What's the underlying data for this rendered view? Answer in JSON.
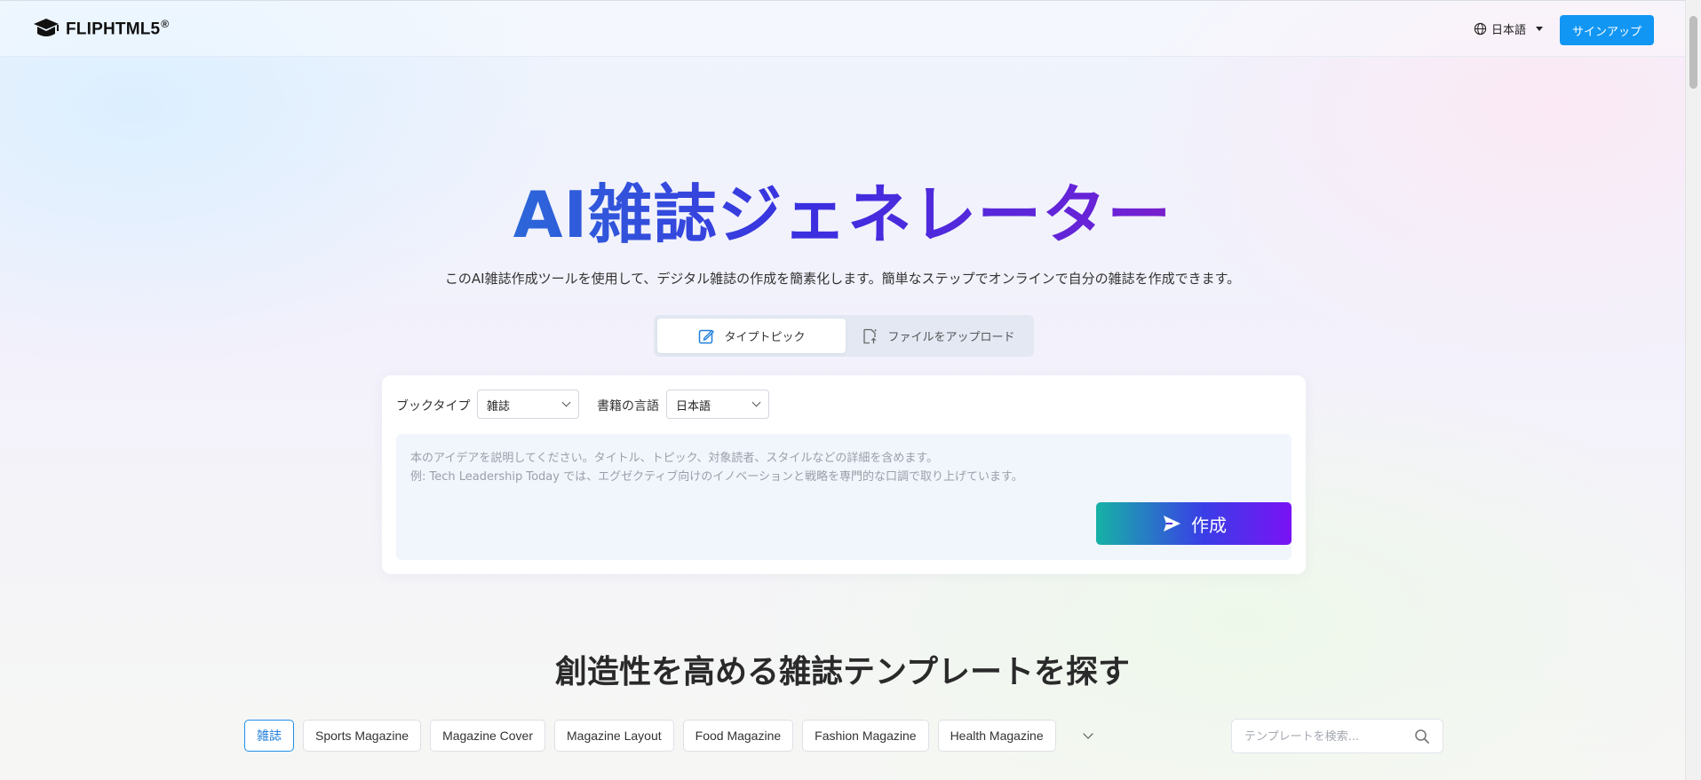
{
  "header": {
    "brand": "FLIPHTML5",
    "brand_mark": "®",
    "language": "日本語",
    "signup_label": "サインアップ"
  },
  "hero": {
    "title": "AI雑誌ジェネレーター",
    "subtitle": "このAI雑誌作成ツールを使用して、デジタル雑誌の作成を簡素化します。簡単なステップでオンラインで自分の雑誌を作成できます。",
    "tabs": [
      {
        "label": "タイプトピック",
        "icon": "edit-icon",
        "active": true
      },
      {
        "label": "ファイルをアップロード",
        "icon": "file-upload-icon",
        "active": false
      }
    ]
  },
  "form": {
    "book_type_label": "ブックタイプ",
    "book_type_value": "雑誌",
    "language_label": "書籍の言語",
    "language_value": "日本語",
    "placeholder_line1": "本のアイデアを説明してください。タイトル、トピック、対象読者、スタイルなどの詳細を含めます。",
    "placeholder_line2": "例: Tech Leadership Today では、エグゼクティブ向けのイノベーションと戦略を専門的な口調で取り上げています。",
    "create_label": "作成"
  },
  "templates": {
    "title": "創造性を高める雑誌テンプレートを探す",
    "categories": [
      "雑誌",
      "Sports Magazine",
      "Magazine Cover",
      "Magazine Layout",
      "Food Magazine",
      "Fashion Magazine",
      "Health Magazine"
    ],
    "search_placeholder": "テンプレートを検索..."
  },
  "colors": {
    "accent": "#1296f3",
    "create_gradient": [
      "#16b2a6",
      "#3a3ee6",
      "#7a12f5"
    ],
    "title_gradient": [
      "#1ab5b5",
      "#2a6fd8",
      "#3b2fe0",
      "#6a22d6",
      "#c0169a",
      "#d4107a"
    ]
  }
}
